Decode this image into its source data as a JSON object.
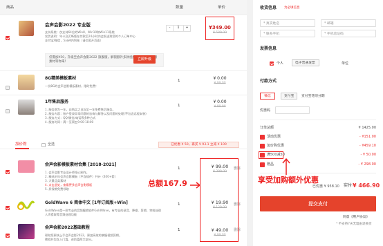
{
  "header": {
    "col_product": "商品",
    "col_qty": "数量",
    "col_price": "单价"
  },
  "main": {
    "title": "会声会影2022 专业版",
    "desc_lines": [
      "支持系统：仅支持64位的Win8、Win10和Win11系统",
      "发货说明：年卡及买断版在付款后24小时内会发送到您的个人订单中心",
      "支付宝/微信，5分钟内到账（请勿离开页面）"
    ],
    "qty": "1",
    "price": "¥349.00",
    "old_price": "¥ 589.00",
    "upgrade_text": "仅需加¥50，升级至会声会影2022 旗舰版，解锁额外多款视频特效，还有创意素材等你来！",
    "upgrade_btn": "立即升级"
  },
  "items": [
    {
      "title": "8G精美模板素材",
      "desc": "一份8G的会声会影模板素材，限时免费！",
      "qty": "1",
      "price": "¥ 0.00",
      "old": "¥ 99.00"
    },
    {
      "title": "1年售后服务",
      "desc_lines": [
        "1. 服务期为一年，自购买之日起至一年免费售后服务。",
        "2. 服务内容：账户登录异常问题的咨询与解答以及问题的处理(不包含远程安装)",
        "3. 服务方式：QQ/微信/电话等多种方式",
        "4. 服务时间：周一至周五9:00-18:00"
      ],
      "qty": "1",
      "price": "¥ 0.00",
      "old": "¥ 99.00"
    }
  ],
  "addon": {
    "tab": "加价购",
    "all_label": "全选",
    "summary": "已优惠 ¥ 50，再买 ¥ 93.1 立减 ¥ 100"
  },
  "addon_items": [
    {
      "title": "会声会影模板素材合集 [2018-2021]",
      "desc_lines": [
        "1. 会声会影专业设计师倾心制作。",
        "2. 精选历年会声会影模板（不含插件）共计（400+套）",
        "3. 大量品类素材",
        "4. 点击此处，查看更多会声会影模板",
        "5. 质保期免费领取"
      ],
      "qty": "1",
      "price": "¥ 99.00",
      "old": "¥ 399.00",
      "checked": true
    },
    {
      "title": "GoldWave 6 简体中文 [1年订阅版+Win]",
      "desc_lines": [
        "GoldWave是一款专业的音频编辑软件GoldWave，有专业的录音、降噪、剪辑、特效处理",
        "人声提取等音频处理功能"
      ],
      "qty": "1",
      "price": "¥ 19.90",
      "old": "¥ 129.00",
      "checked": true
    },
    {
      "title": "会声会影2022基础教程",
      "desc_lines": [
        "帮助您更快上手会声会影2022，更加高效的掌握视频剪辑。",
        "教程共包含入门篇、进阶篇两大部分。"
      ],
      "qty": "1",
      "price": "¥ 49.00",
      "old": "¥ 99.00",
      "checked": true
    }
  ],
  "delete_label": "删除",
  "annotations": {
    "total": "总额167.9",
    "extra": "享受加购额外优惠"
  },
  "right": {
    "receiver_title": "收货信息",
    "receiver_hint": "为必填信息",
    "fields": {
      "name": "* 真实姓名",
      "email": "* 邮箱",
      "phone": "* 联系手机",
      "phone2": "* 手机验证码"
    },
    "invoice_title": "发票信息",
    "invoice_opts": [
      "个人",
      "电子普通发票",
      "单位"
    ],
    "pay_title": "付款方式",
    "pay_opts": [
      "微信",
      "支付宝",
      "支付宝花呗分期"
    ],
    "coupon_label": "优惠码",
    "summary_title": "订单总额",
    "summary_total": "¥ 1425.00",
    "rows": [
      {
        "label": "活动优惠",
        "value": "- ¥151.00"
      },
      {
        "label": "加价购优惠",
        "value": "- ¥459.10"
      },
      {
        "label": "满500减50",
        "value": "- ¥ 50.00"
      },
      {
        "label": "赠品",
        "value": "- ¥ 298.00"
      }
    ],
    "saved": "已优惠 ¥ 958.10",
    "pay_label": "实付",
    "pay_value": "¥ 466.90",
    "submit": "提交支付",
    "agree": "同意《用户协议》",
    "note": "* 不支持7天无理由退换货"
  },
  "colors": {
    "accent": "#e5432c",
    "annotation": "#e22222"
  }
}
